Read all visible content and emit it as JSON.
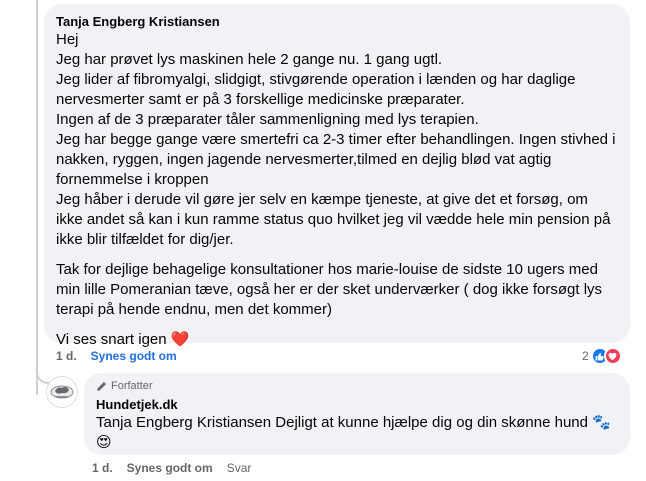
{
  "comment": {
    "author": "Tanja Engberg Kristiansen",
    "paragraphs": [
      "Hej\nJeg har prøvet lys maskinen hele 2 gange nu. 1 gang ugtl.\nJeg lider af fibromyalgi, slidgigt, stivgørende operation i lænden og har daglige nervesmerter samt er på 3 forskellige medicinske præparater.\nIngen af de 3 præparater tåler sammenligning med lys terapien.\nJeg har begge gange være smertefri ca 2-3 timer efter behandlingen. Ingen stivhed i nakken, ryggen, ingen jagende nervesmerter,tilmed en dejlig blød vat agtig fornemmelse i kroppen\nJeg håber i derude vil gøre jer selv en kæmpe tjeneste, at give det et forsøg, om ikke andet så kan i kun ramme status quo hvilket jeg vil vædde hele min pension på ikke blir tilfældet for dig/jer.",
      "Tak for dejlige behagelige konsultationer hos marie-louise de sidste 10 ugers med min lille Pomeranian tæve, også her er der sket underværker ( dog ikke forsøgt lys terapi på hende endnu, men det kommer)",
      "Vi ses snart igen"
    ],
    "heart": "❤️",
    "time": "1 d.",
    "like_label": "Synes godt om",
    "reaction_count": "2",
    "reaction_icons": [
      "like-icon",
      "love-icon"
    ]
  },
  "reply": {
    "badge": "Forfatter",
    "author": "Hundetjek.dk",
    "mention": "Tanja Engberg Kristiansen",
    "text": " Dejligt at kunne hjælpe dig og din skønne hund 🐾",
    "emoji_line": "😍",
    "time": "1 d.",
    "like_label": "Synes godt om",
    "reply_label": "Svar"
  },
  "colors": {
    "bubble": "#f0f2f5",
    "link": "#216fdb",
    "like": "#1877f2",
    "love": "#f33e58"
  }
}
